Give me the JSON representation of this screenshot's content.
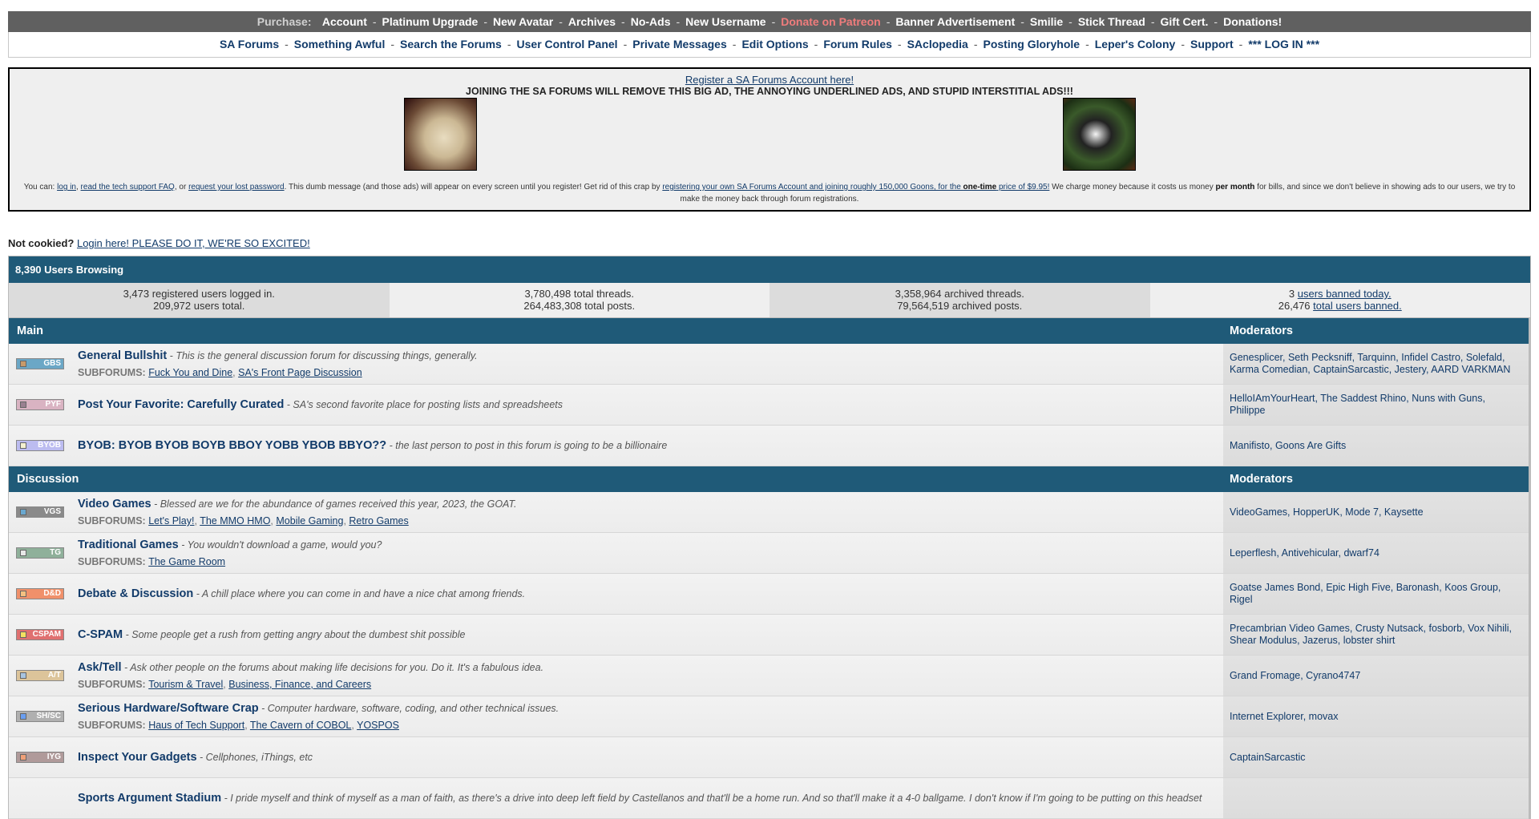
{
  "purchase_bar": {
    "label": "Purchase:",
    "items": [
      {
        "label": "Account"
      },
      {
        "label": "Platinum Upgrade"
      },
      {
        "label": "New Avatar"
      },
      {
        "label": "Archives"
      },
      {
        "label": "No-Ads"
      },
      {
        "label": "New Username"
      },
      {
        "label": "Donate on Patreon",
        "highlight": true
      },
      {
        "label": "Banner Advertisement"
      },
      {
        "label": "Smilie"
      },
      {
        "label": "Stick Thread"
      },
      {
        "label": "Gift Cert."
      },
      {
        "label": "Donations!"
      }
    ]
  },
  "nav_bar": {
    "items": [
      {
        "label": "SA Forums"
      },
      {
        "label": "Something Awful"
      },
      {
        "label": "Search the Forums"
      },
      {
        "label": "User Control Panel"
      },
      {
        "label": "Private Messages"
      },
      {
        "label": "Edit Options"
      },
      {
        "label": "Forum Rules"
      },
      {
        "label": "SAclopedia"
      },
      {
        "label": "Posting Gloryhole"
      },
      {
        "label": "Leper's Colony"
      },
      {
        "label": "Support"
      },
      {
        "label": "*** LOG IN ***"
      }
    ]
  },
  "ad": {
    "register_link": "Register a SA Forums Account here!",
    "shout": "JOINING THE SA FORUMS WILL REMOVE THIS BIG AD, THE ANNOYING UNDERLINED ADS, AND STUPID INTERSTITIAL ADS!!!",
    "fine": {
      "you_can": "You can: ",
      "log_in": "log in",
      "comma1": ", ",
      "faq": "read the tech support FAQ",
      "or": ", or ",
      "lost_pw": "request your lost password",
      "mid": ". This dumb message (and those ads) will appear on every screen until you register! Get rid of this crap by ",
      "reg_link_a": "registering your own SA Forums Account and joining roughly 150,000 Goons, for the ",
      "reg_link_b": "one-time",
      "reg_link_c": " price of $9.95!",
      "after": " We charge money because it costs us money ",
      "per_month": "per month",
      "tail": " for bills, and since we don't believe in showing ads to our users, we try to make the money back through forum registrations."
    }
  },
  "not_cookied": {
    "label": "Not cookied?",
    "link": "Login here! PLEASE DO IT, WE'RE SO EXCITED!"
  },
  "stats": {
    "header": "8,390 Users Browsing",
    "cells": [
      {
        "line1": "3,473 registered users logged in.",
        "line2": "209,972 users total."
      },
      {
        "line1": "3,780,498 total threads.",
        "line2": "264,483,308 total posts."
      },
      {
        "line1": "3,358,964 archived threads.",
        "line2": "79,564,519 archived posts."
      }
    ],
    "banned": {
      "today_count": "3 ",
      "today_link": "users banned today.",
      "total_count": "26,476 ",
      "total_link": "total users banned."
    }
  },
  "categories": [
    {
      "name": "Main",
      "mod_header": "Moderators",
      "forums": [
        {
          "tag": "GBS",
          "color": "#6ba7c6",
          "sq": "#c89a6a",
          "title": "General Bullshit",
          "desc": "This is the general discussion forum for discussing things, generally.",
          "subforums": [
            "Fuck You and Dine",
            "SA's Front Page Discussion"
          ],
          "mods": "Genesplicer, Seth Pecksniff, Tarquinn, Infidel Castro, Solefald, Karma Comedian, CaptainSarcastic, Jestery, AARD VARKMAN"
        },
        {
          "tag": "PYF",
          "color": "#d9b3c2",
          "sq": "#9a8090",
          "title": "Post Your Favorite: Carefully Curated",
          "desc": "SA's second favorite place for posting lists and spreadsheets",
          "subforums": [],
          "mods": "HelloIAmYourHeart, The Saddest Rhino, Nuns with Guns, Philippe"
        },
        {
          "tag": "BYOB",
          "color": "#bcbcf0",
          "sq": "#f4f0d0",
          "title": "BYOB: BYOB BYOB BOYB BBOY YOBB YBOB BBYO??",
          "desc": "the last person to post in this forum is going to be a billionaire",
          "subforums": [],
          "mods": "Manifisto, Goons Are Gifts"
        }
      ]
    },
    {
      "name": "Discussion",
      "mod_header": "Moderators",
      "forums": [
        {
          "tag": "VGS",
          "color": "#8a8a8a",
          "sq": "#6aa8d0",
          "title": "Video Games",
          "desc": "Blessed are we for the abundance of games received this year, 2023, the GOAT.",
          "subforums": [
            "Let's Play!",
            "The MMO HMO",
            "Mobile Gaming",
            "Retro Games"
          ],
          "mods": "VideoGames, HopperUK, Mode 7, Kaysette"
        },
        {
          "tag": "TG",
          "color": "#8fb09a",
          "sq": "#e8e8e8",
          "title": "Traditional Games",
          "desc": "You wouldn't download a game, would you?",
          "subforums": [
            "The Game Room"
          ],
          "mods": "Leperflesh, Antivehicular, dwarf74"
        },
        {
          "tag": "D&D",
          "color": "#f0906a",
          "sq": "#f4c080",
          "title": "Debate & Discussion",
          "desc": "A chill place where you can come in and have a nice chat among friends.",
          "subforums": [],
          "mods": "Goatse James Bond, Epic High Five, Baronash, Koos Group, Rigel"
        },
        {
          "tag": "CSPAM",
          "color": "#e07070",
          "sq": "#f4e060",
          "title": "C-SPAM",
          "desc": "Some people get a rush from getting angry about the dumbest shit possible",
          "subforums": [],
          "mods": "Precambrian Video Games, Crusty Nutsack, fosborb, Vox Nihili, Shear Modulus, Jazerus, lobster shirt"
        },
        {
          "tag": "A/T",
          "color": "#dcc49a",
          "sq": "#a8c4e0",
          "title": "Ask/Tell",
          "desc": "Ask other people on the forums about making life decisions for you. Do it. It's a fabulous idea.",
          "subforums": [
            "Tourism & Travel",
            "Business, Finance, and Careers"
          ],
          "mods": "Grand Fromage, Cyrano4747"
        },
        {
          "tag": "SH/SC",
          "color": "#b0b0b0",
          "sq": "#6a9ef0",
          "title": "Serious Hardware/Software Crap",
          "desc": "Computer hardware, software, coding, and other technical issues.",
          "subforums": [
            "Haus of Tech Support",
            "The Cavern of COBOL",
            "YOSPOS"
          ],
          "mods": "Internet Explorer, movax"
        },
        {
          "tag": "IYG",
          "color": "#b09a9a",
          "sq": "#f0a078",
          "title": "Inspect Your Gadgets",
          "desc": "Cellphones, iThings, etc",
          "subforums": [],
          "mods": "CaptainSarcastic"
        },
        {
          "tag": "",
          "color": "#f0f0f0",
          "sq": "#f0f0f0",
          "title": "Sports Argument Stadium",
          "desc": "I pride myself and think of myself as a man of faith, as there's a drive into deep left field by Castellanos and that'll be a home run. And so that'll make it a 4-0 ballgame. I don't know if I'm going to be putting on this headset",
          "subforums": [],
          "mods": ""
        }
      ]
    }
  ]
}
